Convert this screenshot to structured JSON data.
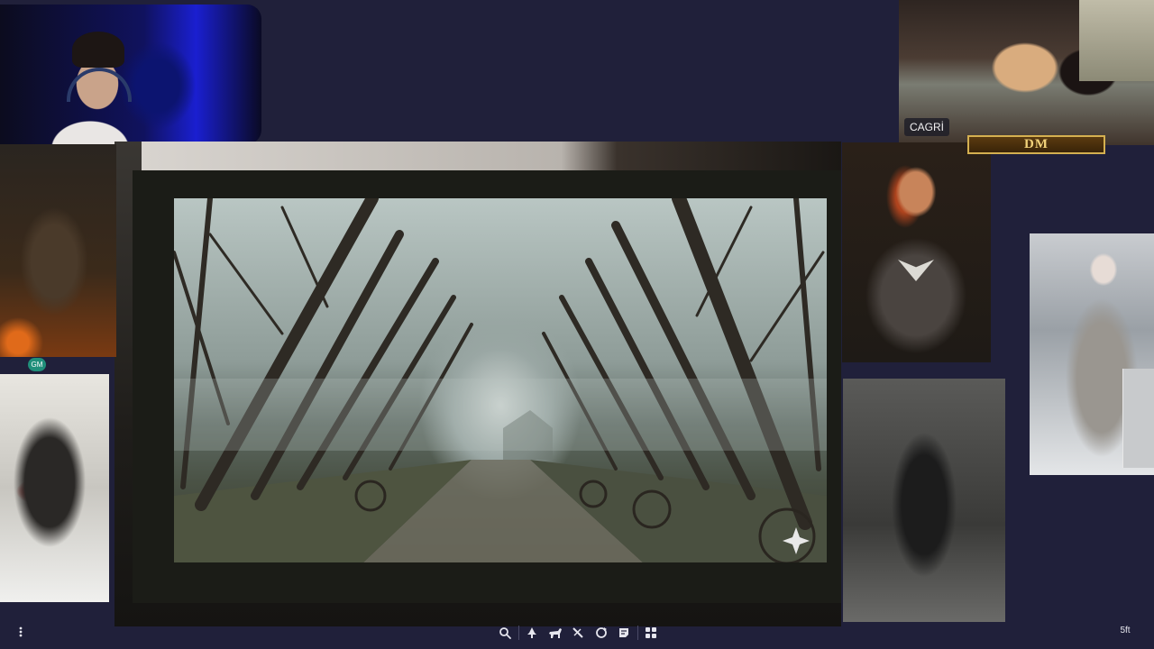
{
  "webcams": {
    "player": {
      "name": ""
    },
    "dm": {
      "name": "CAGRİ"
    }
  },
  "tokens": {
    "gm_badge": "GM",
    "dm_label": "DM"
  },
  "toolbar": {
    "tools": [
      {
        "name": "zoom-tool",
        "icon": "search-icon"
      },
      {
        "name": "pin-tool",
        "icon": "pin-icon"
      },
      {
        "name": "creature-tool",
        "icon": "horse-icon"
      },
      {
        "name": "measure-tool",
        "icon": "ruler-pencil-icon"
      },
      {
        "name": "refresh-tool",
        "icon": "circle-arrow-icon"
      },
      {
        "name": "note-tool",
        "icon": "note-icon"
      },
      {
        "name": "apps-tool",
        "icon": "grid-icon"
      }
    ]
  },
  "grid_scale": "5ft",
  "colors": {
    "background": "#20203a",
    "gm_badge": "#1f8f7a",
    "dm_gold": "#d4b050"
  }
}
